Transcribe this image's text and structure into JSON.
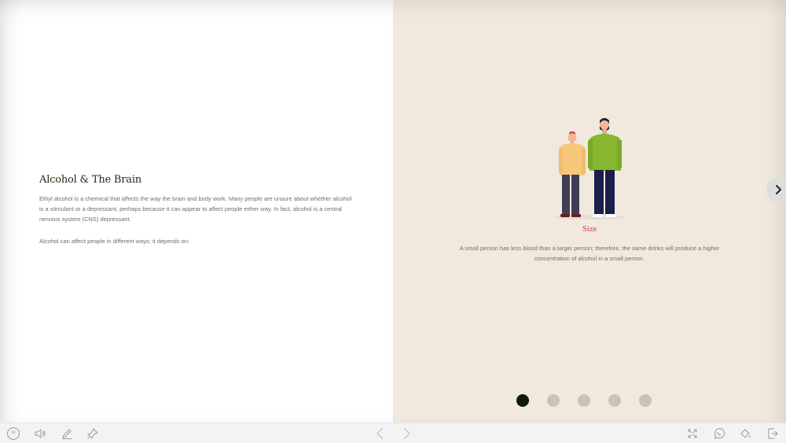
{
  "lesson": {
    "title": "Alcohol & The Brain",
    "paragraph1": "Ethyl alcohol is a chemical that affects the way the brain and body work. Many people are unsure about whether alcohol is a stimulant or a depressant, perhaps because it can appear to affect people either way. In fact, alcohol is a central nervous system (CNS) depressant.",
    "paragraph2": "Alcohol can affect people in different ways; it depends on:"
  },
  "card": {
    "heading": "Size",
    "text": "A small person has less blood than a larger person; therefore, the same drinks will produce a higher concentration of alcohol in a small person.",
    "illustration": "two-people-different-sizes"
  },
  "carousel": {
    "total": 5,
    "active_index": 0
  },
  "toolbar": {
    "zoom_label": "1x",
    "left_icons": [
      "speed-icon",
      "volume-icon",
      "pencil-icon",
      "pin-icon"
    ],
    "center_icons": [
      "chevron-left-icon",
      "chevron-right-icon"
    ],
    "right_icons": [
      "fullscreen-icon",
      "whatsapp-icon",
      "paint-bucket-icon",
      "exit-icon"
    ]
  },
  "colors": {
    "left_background": "#ffffff",
    "right_background": "#f1e9dd",
    "title": "#1c2a12",
    "accent_red": "#c8434b",
    "dot_active": "#0f1a0d",
    "dot_inactive": "#c9c3b6"
  }
}
